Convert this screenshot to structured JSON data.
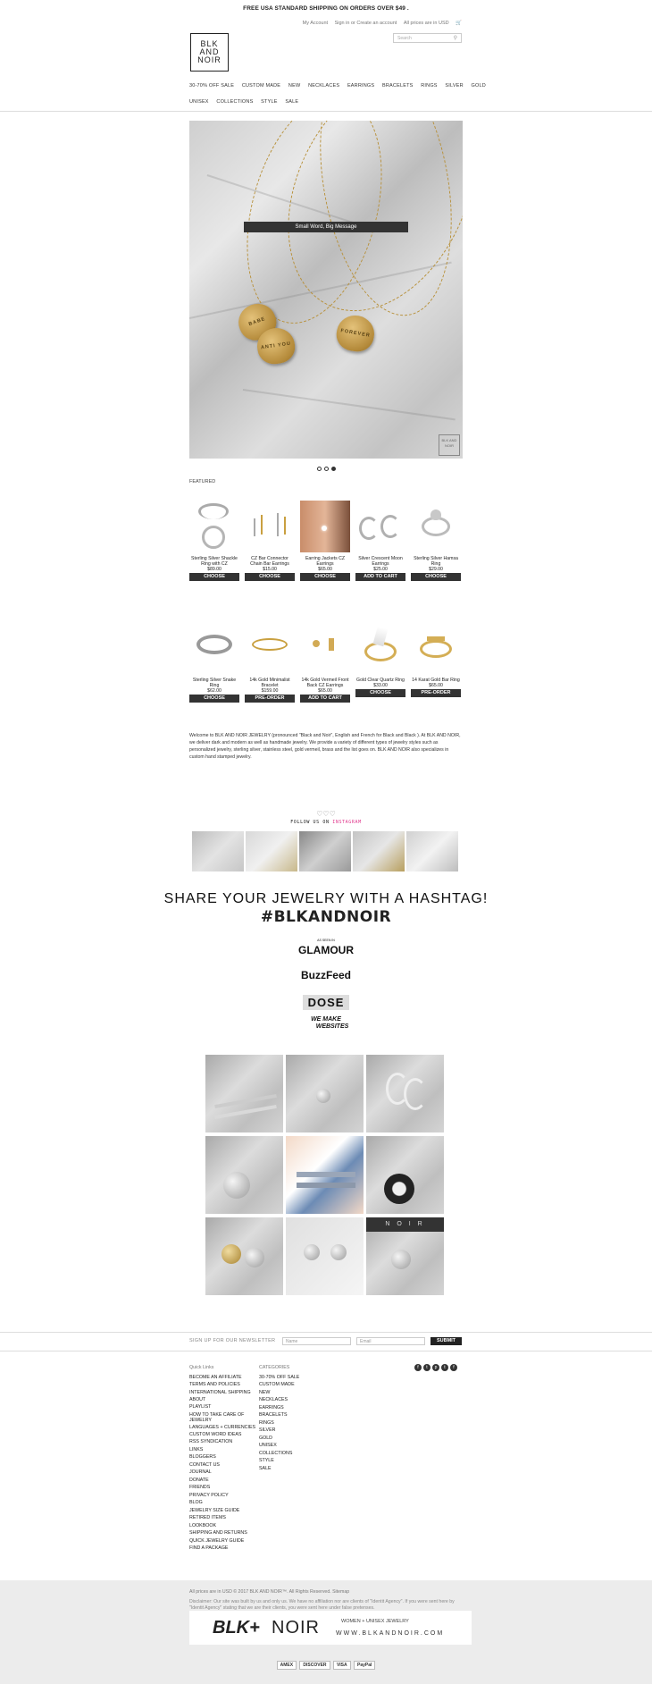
{
  "promo": "FREE USA STANDARD SHIPPING ON ORDERS OVER $49 .",
  "account": {
    "my_account": "My Account",
    "sign_in": "Sign in or Create an account",
    "prices": "All prices are in USD"
  },
  "search": {
    "placeholder": "Search"
  },
  "logo": {
    "line1": "BLK",
    "line2": "AND",
    "line3": "NOIR"
  },
  "nav_row1": [
    "30-70% OFF SALE",
    "CUSTOM MADE",
    "NEW",
    "NECKLACES",
    "EARRINGS",
    "BRACELETS",
    "RINGS",
    "SILVER",
    "GOLD"
  ],
  "nav_row2": [
    "UNISEX",
    "COLLECTIONS",
    "STYLE",
    "SALE"
  ],
  "hero": {
    "caption": "Small Word, Big Message",
    "heart1": "BABE",
    "heart2": "ANTI YOU",
    "heart3": "FOREVER",
    "badge": "BLK AND NOIR"
  },
  "featured_label": "FEATURED",
  "products_row1": [
    {
      "name": "Sterling Silver Shackle Ring with CZ",
      "price": "$89.00",
      "button": "CHOOSE"
    },
    {
      "name": "CZ Bar Connector Chain Bar Earrings",
      "price": "$15.00",
      "button": "CHOOSE"
    },
    {
      "name": "Earring Jackets CZ Earrings",
      "price": "$65.00",
      "button": "CHOOSE"
    },
    {
      "name": "Silver Crescent Moon Earrings",
      "price": "$25.00",
      "button": "ADD TO CART"
    },
    {
      "name": "Sterling Silver Hamsa Ring",
      "price": "$29.00",
      "button": "CHOOSE"
    }
  ],
  "products_row2": [
    {
      "name": "Sterling Silver Snake Ring",
      "price": "$62.00",
      "button": "CHOOSE"
    },
    {
      "name": "14k Gold Minimalist Bracelet",
      "price": "$159.00",
      "button": "PRE-ORDER"
    },
    {
      "name": "14k Gold Vermeil Front Back CZ Earrings",
      "price": "$65.00",
      "button": "ADD TO CART"
    },
    {
      "name": "Gold Clear Quartz Ring",
      "price": "$33.00",
      "button": "CHOOSE"
    },
    {
      "name": "14 Karat Gold Bar Ring",
      "price": "$65.00",
      "button": "PRE-ORDER"
    }
  ],
  "welcome": "Welcome to BLK AND NOIR JEWELRY  (pronounced \"Black and Noir\", English and French for Black and Black ). At BLK AND NOIR, we deliver dark and modern as well as handmade jewelry. We provide a variety of different types of jewelry styles such as personalized jewelry, sterling silver, stainless steel, gold vermeil, brass and the list goes on. BLK AND NOIR also specializes in custom hand stamped jewelry.",
  "follow": {
    "icon": "♡♡♡",
    "prefix": "FOLLOW US ON",
    "platform": "INSTAGRAM"
  },
  "share": "SHARE YOUR JEWELRY WITH A HASHTAG!",
  "hashtag": "#BLKANDNOIR",
  "press": {
    "as_seen": "AS SEEN IN",
    "glamour": "GLAMOUR",
    "buzzfeed": "BuzzFeed",
    "dose": "DOSE",
    "wmw1": "WE MAKE",
    "wmw2": "WEBSITES"
  },
  "newsletter": {
    "label": "SIGN UP FOR OUR NEWSLETTER",
    "name_placeholder": "Name",
    "email_placeholder": "Email",
    "submit": "SUBMIT"
  },
  "quick_links": {
    "heading": "Quick Links",
    "items": [
      "BECOME AN AFFILIATE",
      "TERMS AND POLICIES",
      "INTERNATIONAL SHIPPING",
      "ABOUT",
      "PLAYLIST",
      "HOW TO TAKE CARE OF JEWELRY",
      "LANGUAGES + CURRENCIES",
      "CUSTOM WORD IDEAS",
      "RSS Syndication",
      "LINKS",
      "BLOGGERS",
      "CONTACT US",
      "JOURNAL",
      "DONATE",
      "FRIENDS",
      "Privacy Policy",
      "Blog",
      "JEWELRY SIZE GUIDE",
      "RETIRED ITEMS",
      "LOOKBOOK",
      "SHIPPING AND RETURNS",
      "QUICK JEWELRY GUIDE",
      "FIND A PACKAGE"
    ]
  },
  "categories": {
    "heading": "CATEGORIES",
    "items": [
      "30-70% OFF SALE",
      "CUSTOM MADE",
      "NEW",
      "NECKLACES",
      "EARRINGS",
      "BRACELETS",
      "RINGS",
      "SILVER",
      "GOLD",
      "UNISEX",
      "COLLECTIONS",
      "STYLE",
      "SALE"
    ]
  },
  "social": [
    "f",
    "t",
    "p",
    "t",
    "f"
  ],
  "copyright": "All prices are in USD © 2017 BLK AND NOIR™. All Rights Reserved. Sitemap",
  "disclaimer": "Disclaimer: Our site was built by us and only us. We have no affiliation nor are clients of \"Identit Agency\". If you were sent here by \"Identit Agency\" stating that we are their clients, you were sent here under false pretenses.",
  "footer_banner": {
    "brand_left": "BLK+",
    "brand_right": "NOIR",
    "tagline": "WOMEN + UNISEX JEWELRY",
    "url": "WWW.BLKANDNOIR.COM"
  },
  "payments": [
    "AMEX",
    "DISCOVER",
    "VISA",
    "PayPal"
  ]
}
